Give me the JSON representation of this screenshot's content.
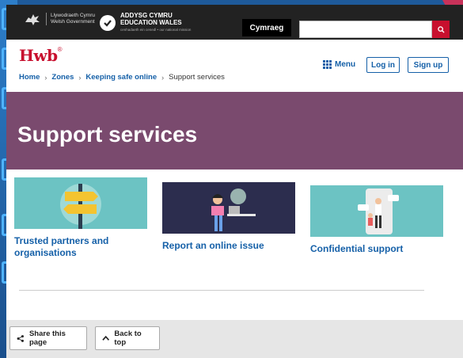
{
  "gov": {
    "welsh_line1": "Llywodraeth Cymru",
    "welsh_line2": "Welsh Government",
    "ew_line1": "ADDYSG CYMRU",
    "ew_line2": "EDUCATION WALES",
    "ew_tagline": "cenhadaeth ein cenedl • our national mission",
    "cymraeg_label": "Cymraeg",
    "search_placeholder": ""
  },
  "header": {
    "logo": "Hwb",
    "logo_mark": "®",
    "menu_label": "Menu",
    "login_label": "Log in",
    "signup_label": "Sign up"
  },
  "breadcrumb": {
    "items": [
      "Home",
      "Zones",
      "Keeping safe online"
    ],
    "current": "Support services"
  },
  "banner": {
    "title": "Support services"
  },
  "cards": [
    {
      "line1": "Trusted partners and",
      "line2": "organisations"
    },
    {
      "line1": "Report an online issue",
      "line2": ""
    },
    {
      "line1": "Confidential support",
      "line2": ""
    }
  ],
  "footer": {
    "share_label": "Share this page",
    "top_label": "Back to top"
  },
  "colors": {
    "accent_red": "#c8102e",
    "link_blue": "#1560a8",
    "banner_purple": "#7a4a6e",
    "card_teal": "#6cc3c3",
    "card_navy": "#2c2d4e"
  }
}
